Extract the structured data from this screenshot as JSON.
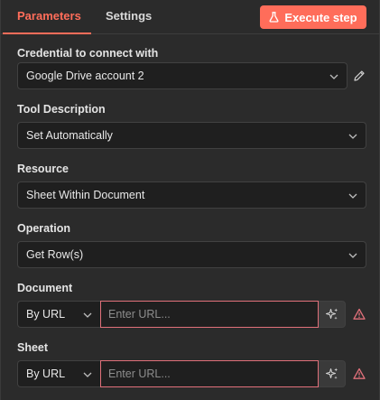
{
  "tabs": [
    {
      "label": "Parameters",
      "active": true
    },
    {
      "label": "Settings",
      "active": false
    }
  ],
  "execute_button": {
    "label": "Execute step",
    "icon": "flask-icon",
    "color": "#ff6d5a"
  },
  "credential": {
    "label": "Credential to connect with",
    "value": "Google Drive account 2",
    "edit_icon": "pencil-icon"
  },
  "tool_description": {
    "label": "Tool Description",
    "value": "Set Automatically"
  },
  "resource": {
    "label": "Resource",
    "value": "Sheet Within Document"
  },
  "operation": {
    "label": "Operation",
    "value": "Get Row(s)"
  },
  "document": {
    "label": "Document",
    "mode": "By URL",
    "placeholder": "Enter URL...",
    "ai_icon": "sparkles-icon",
    "warning_icon": "warning-triangle-icon"
  },
  "sheet": {
    "label": "Sheet",
    "mode": "By URL",
    "placeholder": "Enter URL...",
    "ai_icon": "sparkles-icon",
    "warning_icon": "warning-triangle-icon"
  },
  "colors": {
    "accent": "#ff6d5a",
    "error": "#e0707a",
    "background": "#2b2b2b",
    "field": "#1f1f1f"
  }
}
